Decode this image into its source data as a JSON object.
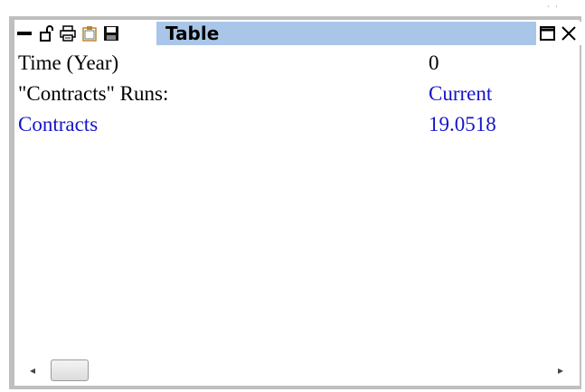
{
  "window": {
    "title": "Table",
    "toolbar_icons": [
      "minimize-bar-icon",
      "lock-icon",
      "print-icon",
      "clipboard-icon",
      "save-icon"
    ],
    "controls": [
      "restore-icon",
      "close-icon"
    ]
  },
  "table": {
    "rows": [
      {
        "label": "Time (Year)",
        "value": "0",
        "color": "#000000"
      },
      {
        "label": "\"Contracts\"  Runs:",
        "value": "Current",
        "color_label": "#000000",
        "color_value": "#1515c8"
      },
      {
        "label": "Contracts",
        "value": "19.0518",
        "color": "#1515c8"
      }
    ]
  },
  "scrollbar": {
    "left_arrow": "◂",
    "right_arrow": "▸"
  },
  "colors": {
    "title_bg": "#a9c6e8",
    "frame": "#bfbfbf",
    "series_blue": "#1515c8"
  }
}
